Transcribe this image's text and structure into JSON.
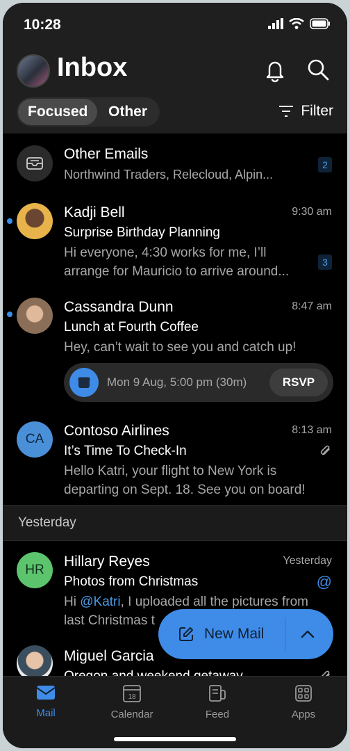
{
  "status_bar": {
    "time": "10:28"
  },
  "header": {
    "title": "Inbox",
    "filter_label": "Filter"
  },
  "tabs": [
    {
      "label": "Focused"
    },
    {
      "label": "Other"
    }
  ],
  "other_emails": {
    "title": "Other Emails",
    "preview": "Northwind Traders, Relecloud, Alpin...",
    "count": "2"
  },
  "messages": [
    {
      "sender": "Kadji Bell",
      "time": "9:30 am",
      "subject": "Surprise Birthday Planning",
      "preview_line1": "Hi everyone, 4:30 works for me, I’ll",
      "preview_line2": "arrange for Mauricio to arrive around...",
      "count": "3",
      "unread": true
    },
    {
      "sender": "Cassandra Dunn",
      "time": "8:47 am",
      "subject": "Lunch at Fourth Coffee",
      "preview_line1": "Hey, can’t wait to see you and catch up!",
      "unread": true,
      "event": {
        "text": "Mon 9 Aug, 5:00 pm (30m)",
        "rsvp_label": "RSVP"
      }
    },
    {
      "sender": "Contoso Airlines",
      "time": "8:13 am",
      "initials": "CA",
      "subject": "It’s Time To Check-In",
      "preview_line1": "Hello Katri, your flight to New York is",
      "preview_line2": "departing on Sept. 18. See you on board!",
      "has_attachment": true
    }
  ],
  "section_yesterday": "Yesterday",
  "messages_yesterday": [
    {
      "sender": "Hillary Reyes",
      "time": "Yesterday",
      "initials": "HR",
      "subject": "Photos from Christmas",
      "preview_prefix": "Hi ",
      "mention": "@Katri",
      "preview_rest": ", I uploaded all the pictures from",
      "preview_line2": "last Christmas t",
      "mention_badge": "@"
    },
    {
      "sender": "Miguel Garcia",
      "subject": "Oregon and weekend getaway",
      "has_attachment": true
    }
  ],
  "fab": {
    "label": "New Mail"
  },
  "tab_bar": [
    {
      "label": "Mail",
      "active": true
    },
    {
      "label": "Calendar",
      "calendar_day": "18"
    },
    {
      "label": "Feed"
    },
    {
      "label": "Apps"
    }
  ],
  "colors": {
    "accent": "#3f8ce8",
    "unread_dot": "#3b8de8",
    "ca_avatar": "#4a90d9",
    "hr_avatar": "#5cc46d"
  }
}
